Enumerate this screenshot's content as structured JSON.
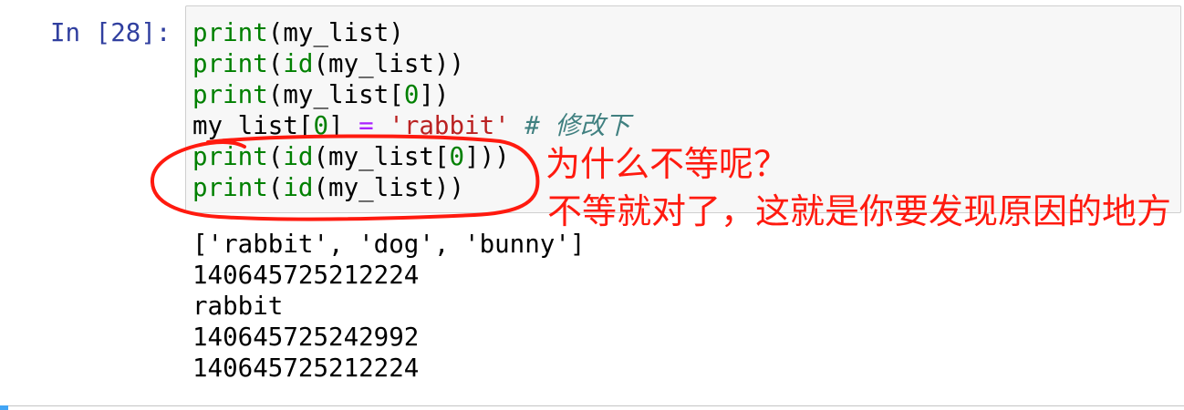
{
  "notebook_cell": {
    "prompt": "In [28]:",
    "input": {
      "lines": [
        {
          "tokens": [
            "print",
            "(my_list)"
          ]
        },
        {
          "tokens": [
            "print",
            "(",
            "id",
            "(my_list))"
          ]
        },
        {
          "tokens": [
            "print",
            "(my_list[",
            "0",
            "])"
          ]
        },
        {
          "tokens": [
            "my_list[",
            "0",
            "] ",
            "=",
            " 'rabbit'",
            " # 修改下"
          ]
        },
        {
          "tokens": [
            "print",
            "(",
            "id",
            "(my_list[",
            "0",
            "]))"
          ]
        },
        {
          "tokens": [
            "print",
            "(",
            "id",
            "(my_list))"
          ]
        }
      ]
    },
    "output": {
      "lines": [
        "['rabbit', 'dog', 'bunny']",
        "140645725212224",
        "rabbit",
        "140645725242992",
        "140645725212224"
      ]
    }
  },
  "annotations": {
    "question": "为什么不等呢？",
    "answer": "不等就对了，这就是你要发现原因的地方"
  },
  "colors": {
    "builtin": "#008000",
    "number": "#008000",
    "operator": "#aa22ff",
    "string": "#ba2121",
    "comment": "#408080",
    "prompt": "#303f9f",
    "annotation": "#ff1a0f",
    "selected_cell": "#42a5f5"
  }
}
